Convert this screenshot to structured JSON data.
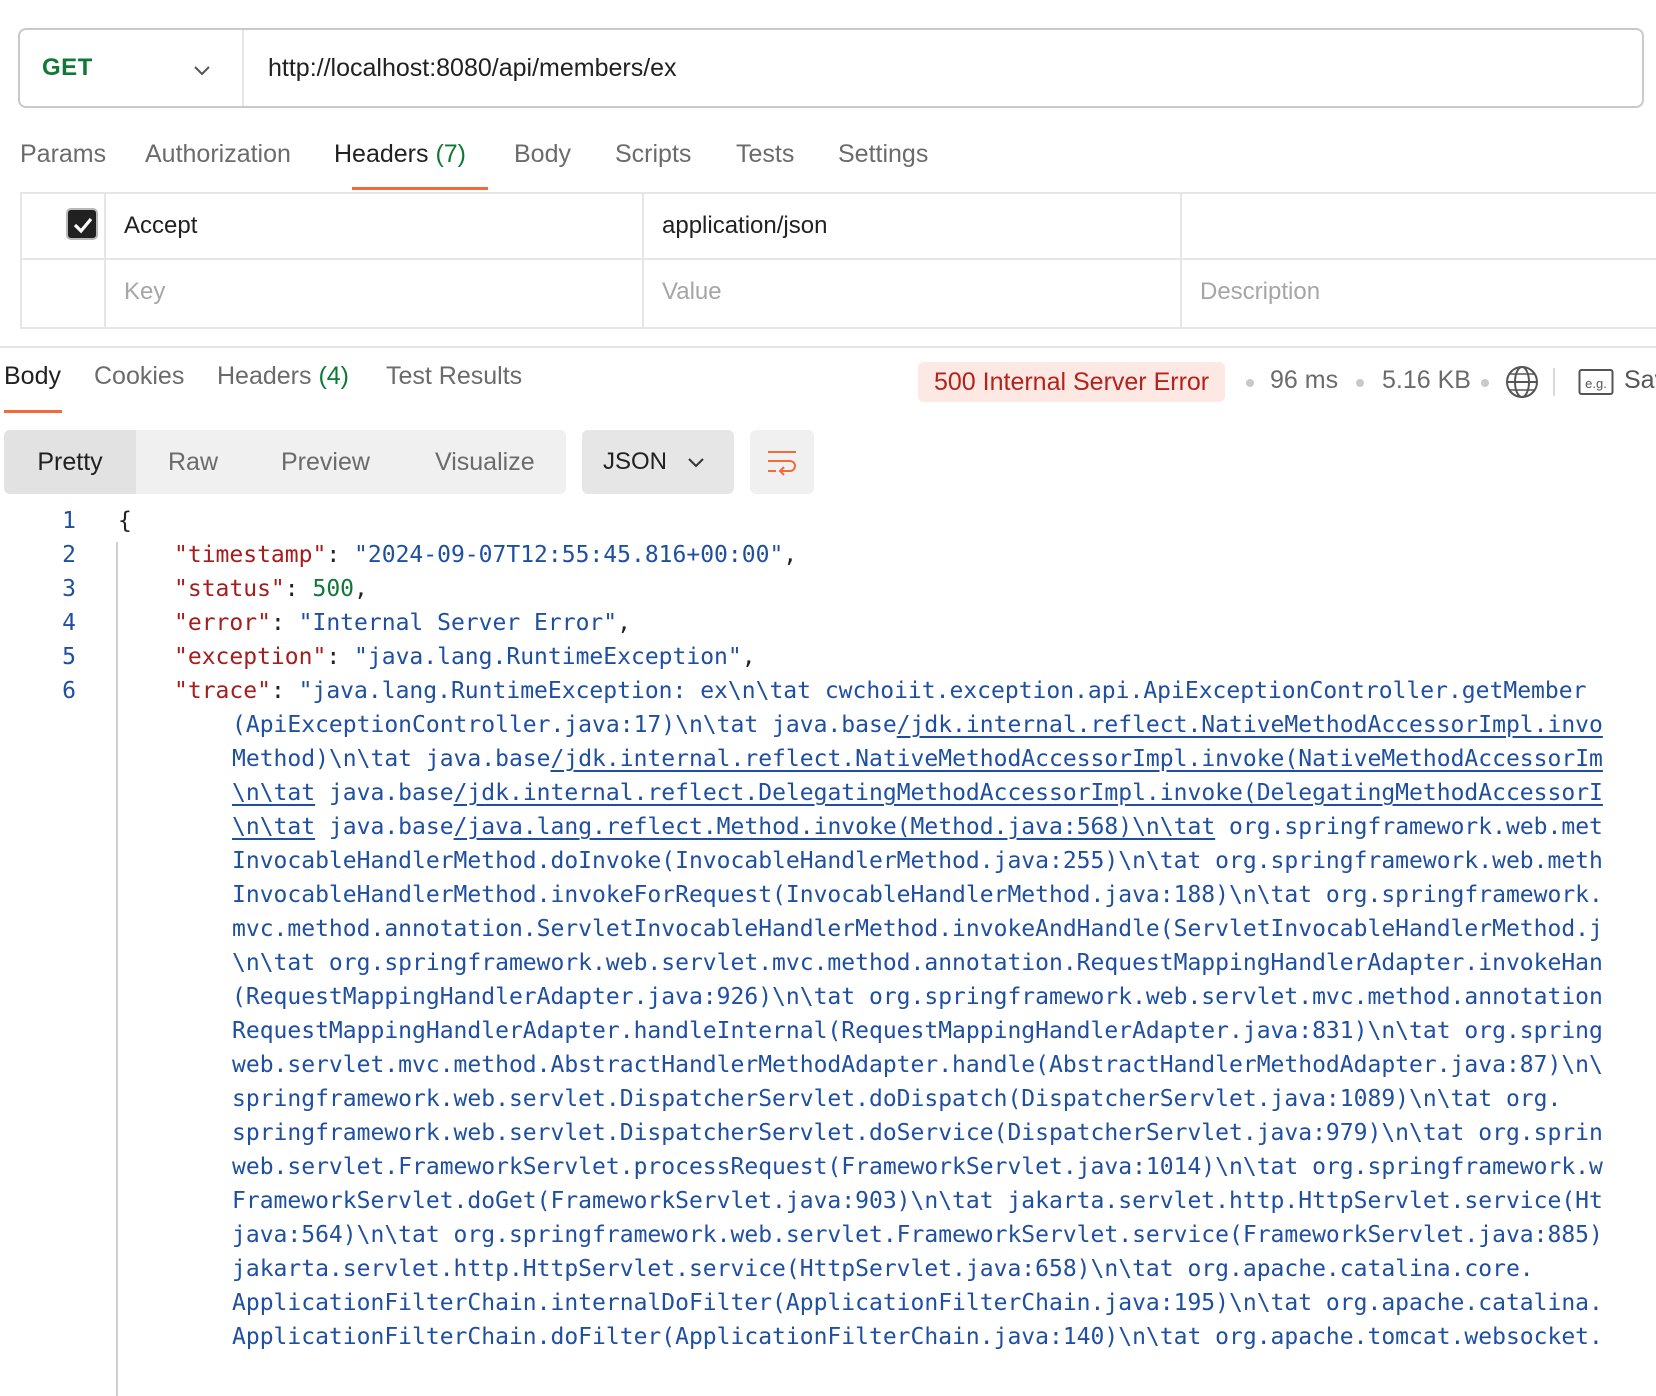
{
  "request": {
    "method": "GET",
    "url": "http://localhost:8080/api/members/ex",
    "tabs": [
      {
        "label": "Params",
        "count": ""
      },
      {
        "label": "Authorization",
        "count": ""
      },
      {
        "label": "Headers",
        "count": "(7)"
      },
      {
        "label": "Body",
        "count": ""
      },
      {
        "label": "Scripts",
        "count": ""
      },
      {
        "label": "Tests",
        "count": ""
      },
      {
        "label": "Settings",
        "count": ""
      }
    ],
    "active_tab": "Headers"
  },
  "headers_table": {
    "rows": [
      {
        "checked": true,
        "key": "Accept",
        "value": "application/json",
        "description": ""
      }
    ],
    "placeholders": {
      "key": "Key",
      "value": "Value",
      "description": "Description"
    }
  },
  "response": {
    "tabs": [
      {
        "label": "Body",
        "count": ""
      },
      {
        "label": "Cookies",
        "count": ""
      },
      {
        "label": "Headers",
        "count": "(4)"
      },
      {
        "label": "Test Results",
        "count": ""
      }
    ],
    "active_tab": "Body",
    "status": "500 Internal Server Error",
    "time": "96 ms",
    "size": "5.16 KB",
    "save_label": "Sav",
    "views": [
      "Pretty",
      "Raw",
      "Preview",
      "Visualize"
    ],
    "active_view": "Pretty",
    "format": "JSON",
    "colors": {
      "status_bg": "#fde8e3",
      "status_text": "#b4231b",
      "accent": "#f26b3a",
      "key": "#a51d1d",
      "string": "#1f4fa0",
      "number": "#0f7a36"
    }
  },
  "code": {
    "line_numbers": [
      "1",
      "2",
      "3",
      "4",
      "5",
      "6"
    ],
    "open_brace": "{",
    "lines": [
      {
        "key": "\"timestamp\"",
        "value": "\"2024-09-07T12:55:45.816+00:00\"",
        "trail": ","
      },
      {
        "key": "\"status\"",
        "value": "500",
        "trail": ","
      },
      {
        "key": "\"error\"",
        "value": "\"Internal Server Error\"",
        "trail": ","
      },
      {
        "key": "\"exception\"",
        "value": "\"java.lang.RuntimeException\"",
        "trail": ","
      },
      {
        "key": "\"trace\"",
        "value": "\"java.lang.RuntimeException: ex\\n\\tat cwchoiit.exception.api.ApiExceptionController.getMember",
        "trail": ""
      }
    ],
    "trace_continuation": [
      [
        "(ApiExceptionController.java:17)\\n\\tat java.base",
        "/jdk.internal.reflect.NativeMethodAccessorImpl.invo"
      ],
      [
        "Method)\\n\\tat java.base",
        "/jdk.internal.reflect.NativeMethodAccessorImpl.invoke(NativeMethodAccessorIm"
      ],
      [
        "",
        "\\n\\tat",
        " java.base",
        "/jdk.internal.reflect.DelegatingMethodAccessorImpl.invoke(DelegatingMethodAccessorI"
      ],
      [
        "",
        "\\n\\tat",
        " java.base",
        "/java.lang.reflect.Method.invoke(Method.java:568)\\n\\tat",
        " org.springframework.web.met"
      ],
      [
        "InvocableHandlerMethod.doInvoke(InvocableHandlerMethod.java:255)\\n\\tat org.springframework.web.meth"
      ],
      [
        "InvocableHandlerMethod.invokeForRequest(InvocableHandlerMethod.java:188)\\n\\tat org.springframework."
      ],
      [
        "mvc.method.annotation.ServletInvocableHandlerMethod.invokeAndHandle(ServletInvocableHandlerMethod.j"
      ],
      [
        "\\n\\tat org.springframework.web.servlet.mvc.method.annotation.RequestMappingHandlerAdapter.invokeHan"
      ],
      [
        "(RequestMappingHandlerAdapter.java:926)\\n\\tat org.springframework.web.servlet.mvc.method.annotation"
      ],
      [
        "RequestMappingHandlerAdapter.handleInternal(RequestMappingHandlerAdapter.java:831)\\n\\tat org.spring"
      ],
      [
        "web.servlet.mvc.method.AbstractHandlerMethodAdapter.handle(AbstractHandlerMethodAdapter.java:87)\\n\\"
      ],
      [
        "springframework.web.servlet.DispatcherServlet.doDispatch(DispatcherServlet.java:1089)\\n\\tat org."
      ],
      [
        "springframework.web.servlet.DispatcherServlet.doService(DispatcherServlet.java:979)\\n\\tat org.sprin"
      ],
      [
        "web.servlet.FrameworkServlet.processRequest(FrameworkServlet.java:1014)\\n\\tat org.springframework.w"
      ],
      [
        "FrameworkServlet.doGet(FrameworkServlet.java:903)\\n\\tat jakarta.servlet.http.HttpServlet.service(Ht"
      ],
      [
        "java:564)\\n\\tat org.springframework.web.servlet.FrameworkServlet.service(FrameworkServlet.java:885)"
      ],
      [
        "jakarta.servlet.http.HttpServlet.service(HttpServlet.java:658)\\n\\tat org.apache.catalina.core."
      ],
      [
        "ApplicationFilterChain.internalDoFilter(ApplicationFilterChain.java:195)\\n\\tat org.apache.catalina."
      ],
      [
        "ApplicationFilterChain.doFilter(ApplicationFilterChain.java:140)\\n\\tat org.apache.tomcat.websocket."
      ]
    ]
  }
}
